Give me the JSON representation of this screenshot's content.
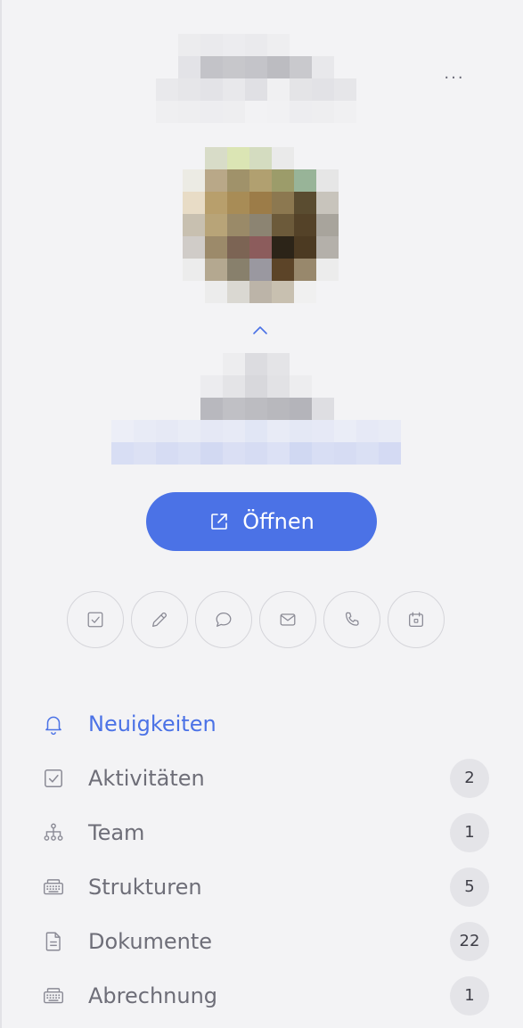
{
  "header": {
    "more_label": "···"
  },
  "open_button": {
    "label": "Öffnen"
  },
  "quick_actions": [
    {
      "icon": "checkbox-icon"
    },
    {
      "icon": "pencil-icon"
    },
    {
      "icon": "chat-bubble-icon"
    },
    {
      "icon": "envelope-icon"
    },
    {
      "icon": "phone-icon"
    },
    {
      "icon": "calendar-icon"
    }
  ],
  "menu": {
    "items": [
      {
        "label": "Neuigkeiten",
        "icon": "bell-icon",
        "active": true
      },
      {
        "label": "Aktivitäten",
        "icon": "checkbox-icon",
        "count": "2"
      },
      {
        "label": "Team",
        "icon": "org-chart-icon",
        "count": "1"
      },
      {
        "label": "Strukturen",
        "icon": "keyboard-icon",
        "count": "5"
      },
      {
        "label": "Dokumente",
        "icon": "document-icon",
        "count": "22"
      },
      {
        "label": "Abrechnung",
        "icon": "keyboard-icon",
        "count": "1"
      }
    ]
  },
  "colors": {
    "accent": "#4b72e6",
    "background": "#f3f3f5",
    "text_muted": "#6e6e78",
    "badge_bg": "#e4e4e8"
  }
}
